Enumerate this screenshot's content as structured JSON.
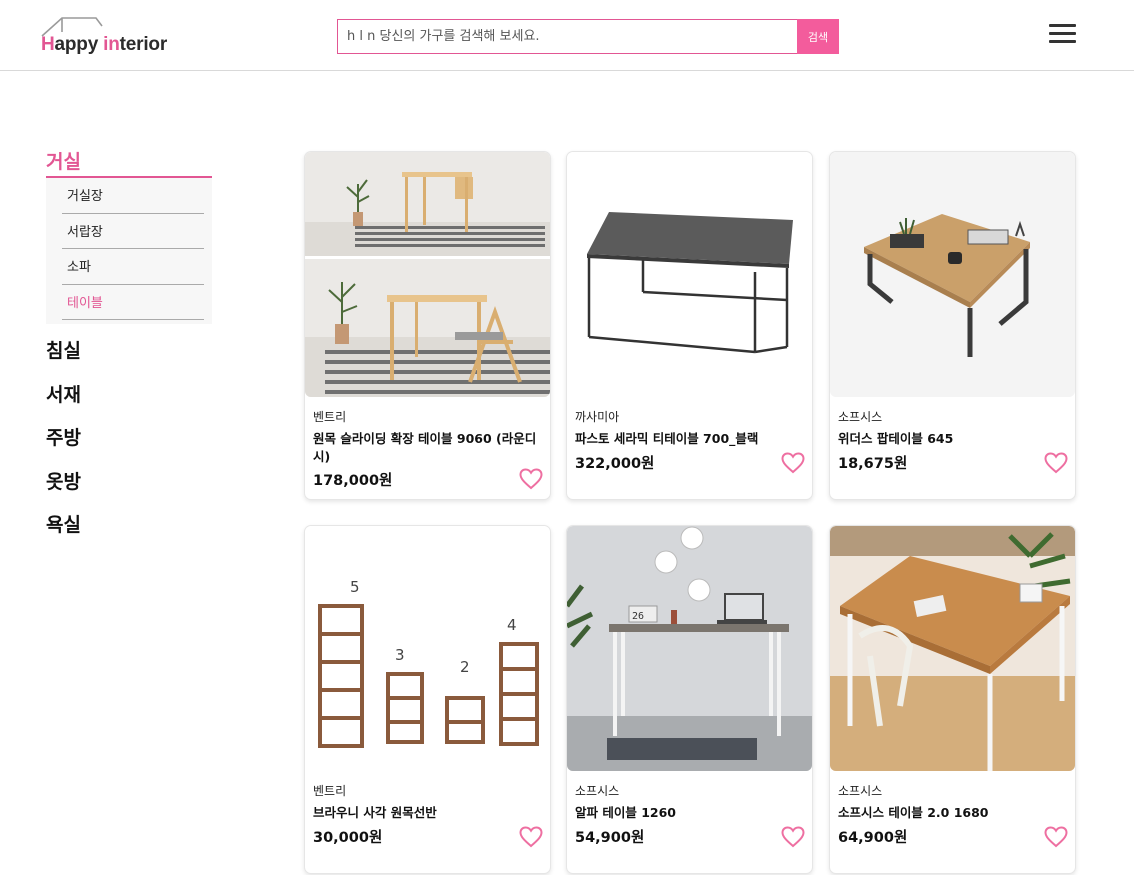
{
  "header": {
    "logo_part1": "H",
    "logo_part2": "appy ",
    "logo_part3": "in",
    "logo_part4": "terior",
    "search_placeholder": "h l n 당신의 가구를 검색해 보세요.",
    "search_button": "검색",
    "menu_icon": "hamburger-menu-icon"
  },
  "sidebar": {
    "active_category": "거실",
    "subcategories": [
      {
        "label": "거실장"
      },
      {
        "label": "서랍장"
      },
      {
        "label": "소파"
      },
      {
        "label": "테이블",
        "active": true
      }
    ],
    "categories": [
      {
        "label": "침실"
      },
      {
        "label": "서재"
      },
      {
        "label": "주방"
      },
      {
        "label": "옷방"
      },
      {
        "label": "욕실"
      }
    ]
  },
  "products": [
    {
      "brand": "벤트리",
      "title": "원목 슬라이딩 확장 테이블 9060 (라운디시)",
      "price": "178,000원",
      "wishlist_icon": "heart-outline-icon"
    },
    {
      "brand": "까사미아",
      "title": "파스토 세라믹 티테이블 700_블랙",
      "price": "322,000원",
      "wishlist_icon": "heart-outline-icon"
    },
    {
      "brand": "소프시스",
      "title": "위더스 팝테이블 645",
      "price": "18,675원",
      "wishlist_icon": "heart-outline-icon"
    },
    {
      "brand": "벤트리",
      "title": "브라우니 사각 원목선반",
      "price": "30,000원",
      "wishlist_icon": "heart-outline-icon"
    },
    {
      "brand": "소프시스",
      "title": "알파 테이블 1260",
      "price": "54,900원",
      "wishlist_icon": "heart-outline-icon"
    },
    {
      "brand": "소프시스",
      "title": "소프시스 테이블 2.0 1680",
      "price": "64,900원",
      "wishlist_icon": "heart-outline-icon"
    }
  ],
  "product_image_labels": {
    "shelf_numbers": [
      "5",
      "3",
      "2",
      "4"
    ],
    "calendar_digits": "26"
  },
  "colors": {
    "accent": "#e25693",
    "search_button": "#f35c9c",
    "heart": "#ee6fa1"
  }
}
